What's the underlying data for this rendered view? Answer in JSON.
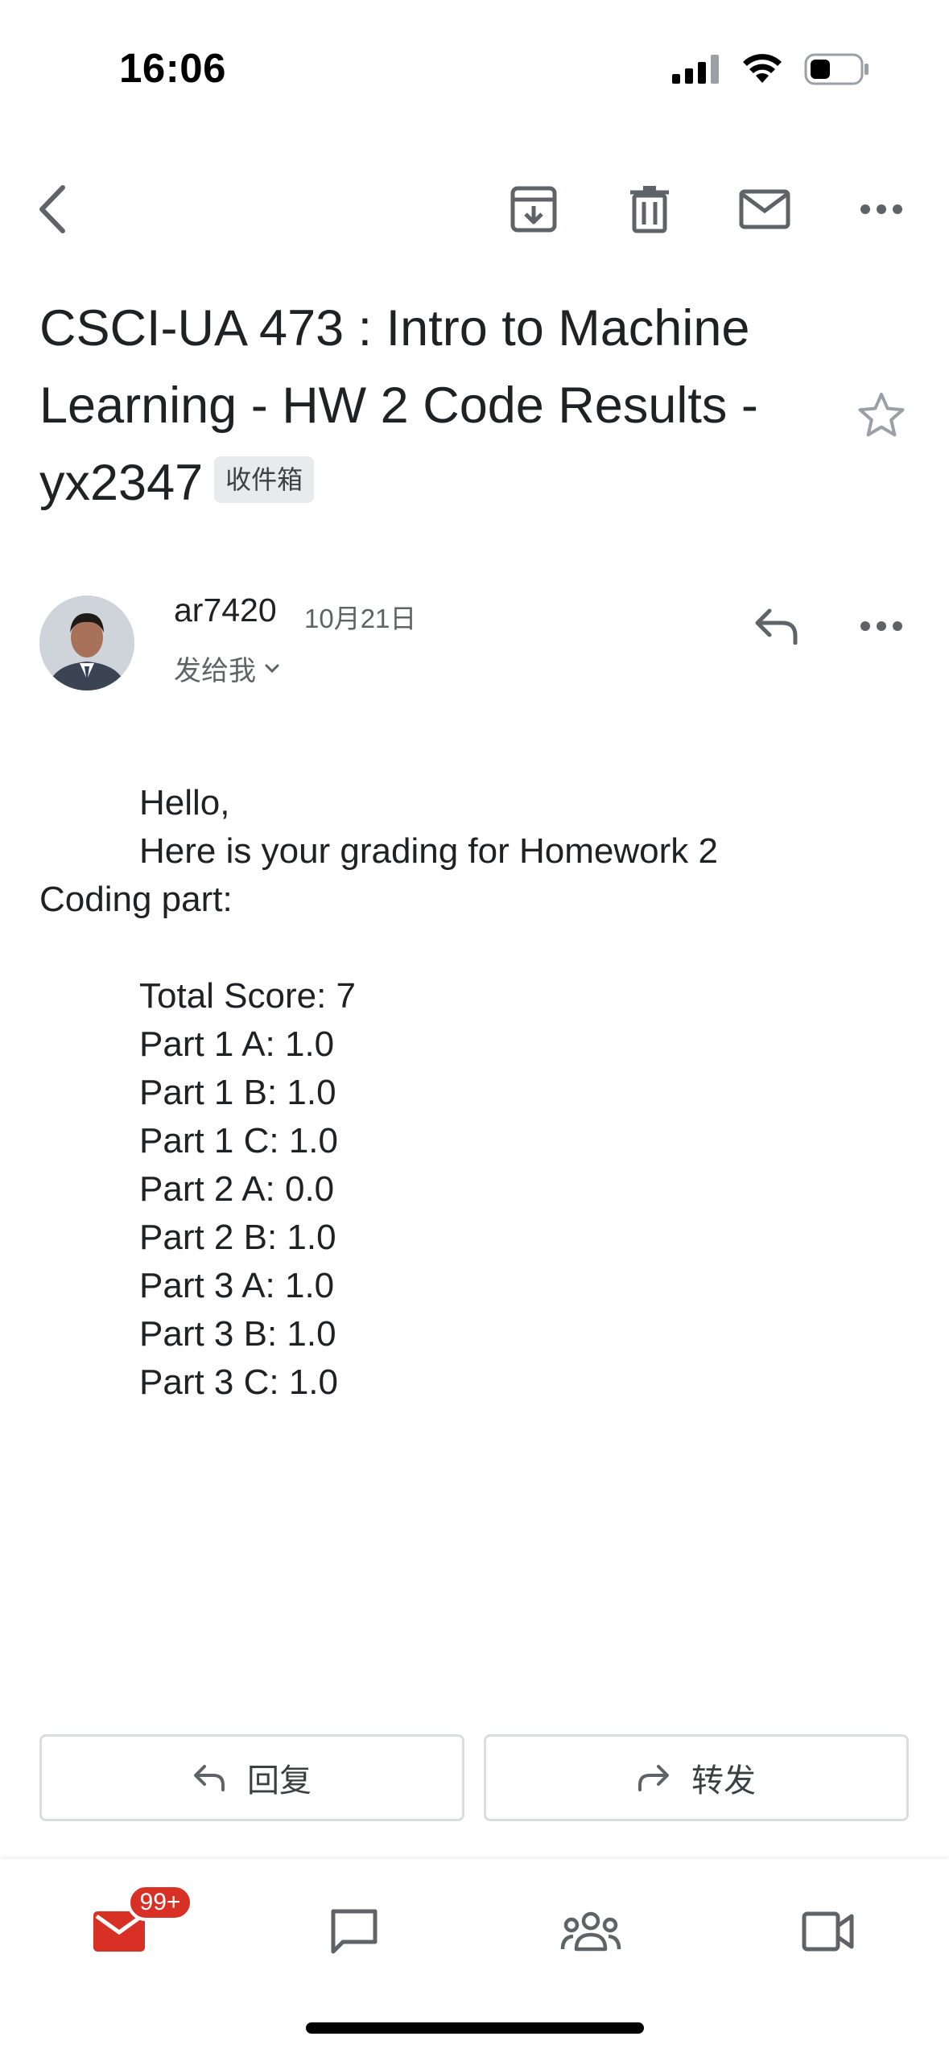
{
  "status_bar": {
    "time": "16:06"
  },
  "email": {
    "subject": "CSCI-UA 473 : Intro to Machine Learning - HW 2 Code Results - yx2347",
    "label": "收件箱",
    "sender": "ar7420",
    "date": "10月21日",
    "recipient": "发给我",
    "body": {
      "greeting": "Hello,",
      "intro_line1": "Here is your grading for Homework 2",
      "intro_line2": "Coding part:",
      "total_score": "Total Score: 7",
      "parts": [
        "Part 1 A: 1.0",
        "Part 1 B: 1.0",
        "Part 1 C: 1.0",
        "Part 2 A: 0.0",
        "Part 2 B: 1.0",
        "Part 3 A: 1.0",
        "Part 3 B: 1.0",
        "Part 3 C: 1.0"
      ]
    }
  },
  "actions": {
    "reply_label": "回复",
    "forward_label": "转发"
  },
  "bottom_nav": {
    "mail_badge": "99+"
  },
  "colors": {
    "mail_red": "#d93025",
    "icon_gray": "#5f6368",
    "text": "#202124"
  }
}
